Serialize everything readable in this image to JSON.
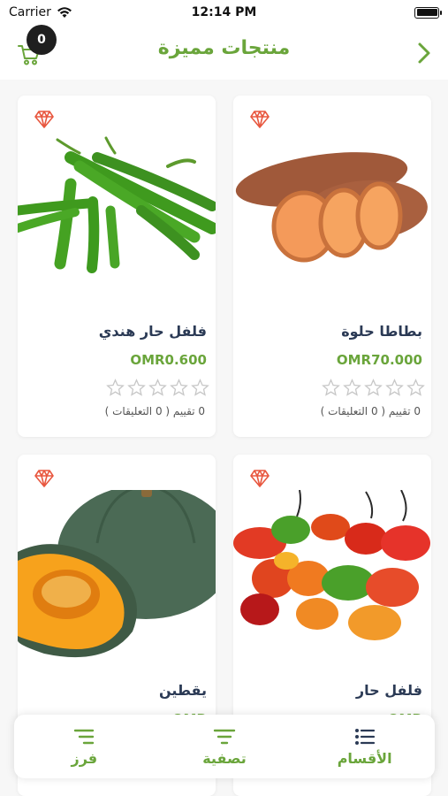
{
  "status_bar": {
    "carrier": "Carrier",
    "time": "12:14 PM"
  },
  "header": {
    "title": "منتجات مميزة",
    "cart_count": "0"
  },
  "products": [
    {
      "name": "بطاطا حلوة",
      "price": "OMR70.000",
      "rating_text": "0 تقييم ( 0 التعليقات )"
    },
    {
      "name": "فلفل حار هندي",
      "price": "OMR0.600",
      "rating_text": "0 تقييم ( 0 التعليقات )"
    },
    {
      "name": "فلفل حار",
      "price": "OMR"
    },
    {
      "name": "يقطين",
      "price": "OMR"
    }
  ],
  "bottom_bar": {
    "categories": "الأقسام",
    "filter": "تصفية",
    "sort": "فرز"
  },
  "colors": {
    "accent": "#6aa53b",
    "title_text": "#2b3a55",
    "diamond": "#e8573f"
  }
}
